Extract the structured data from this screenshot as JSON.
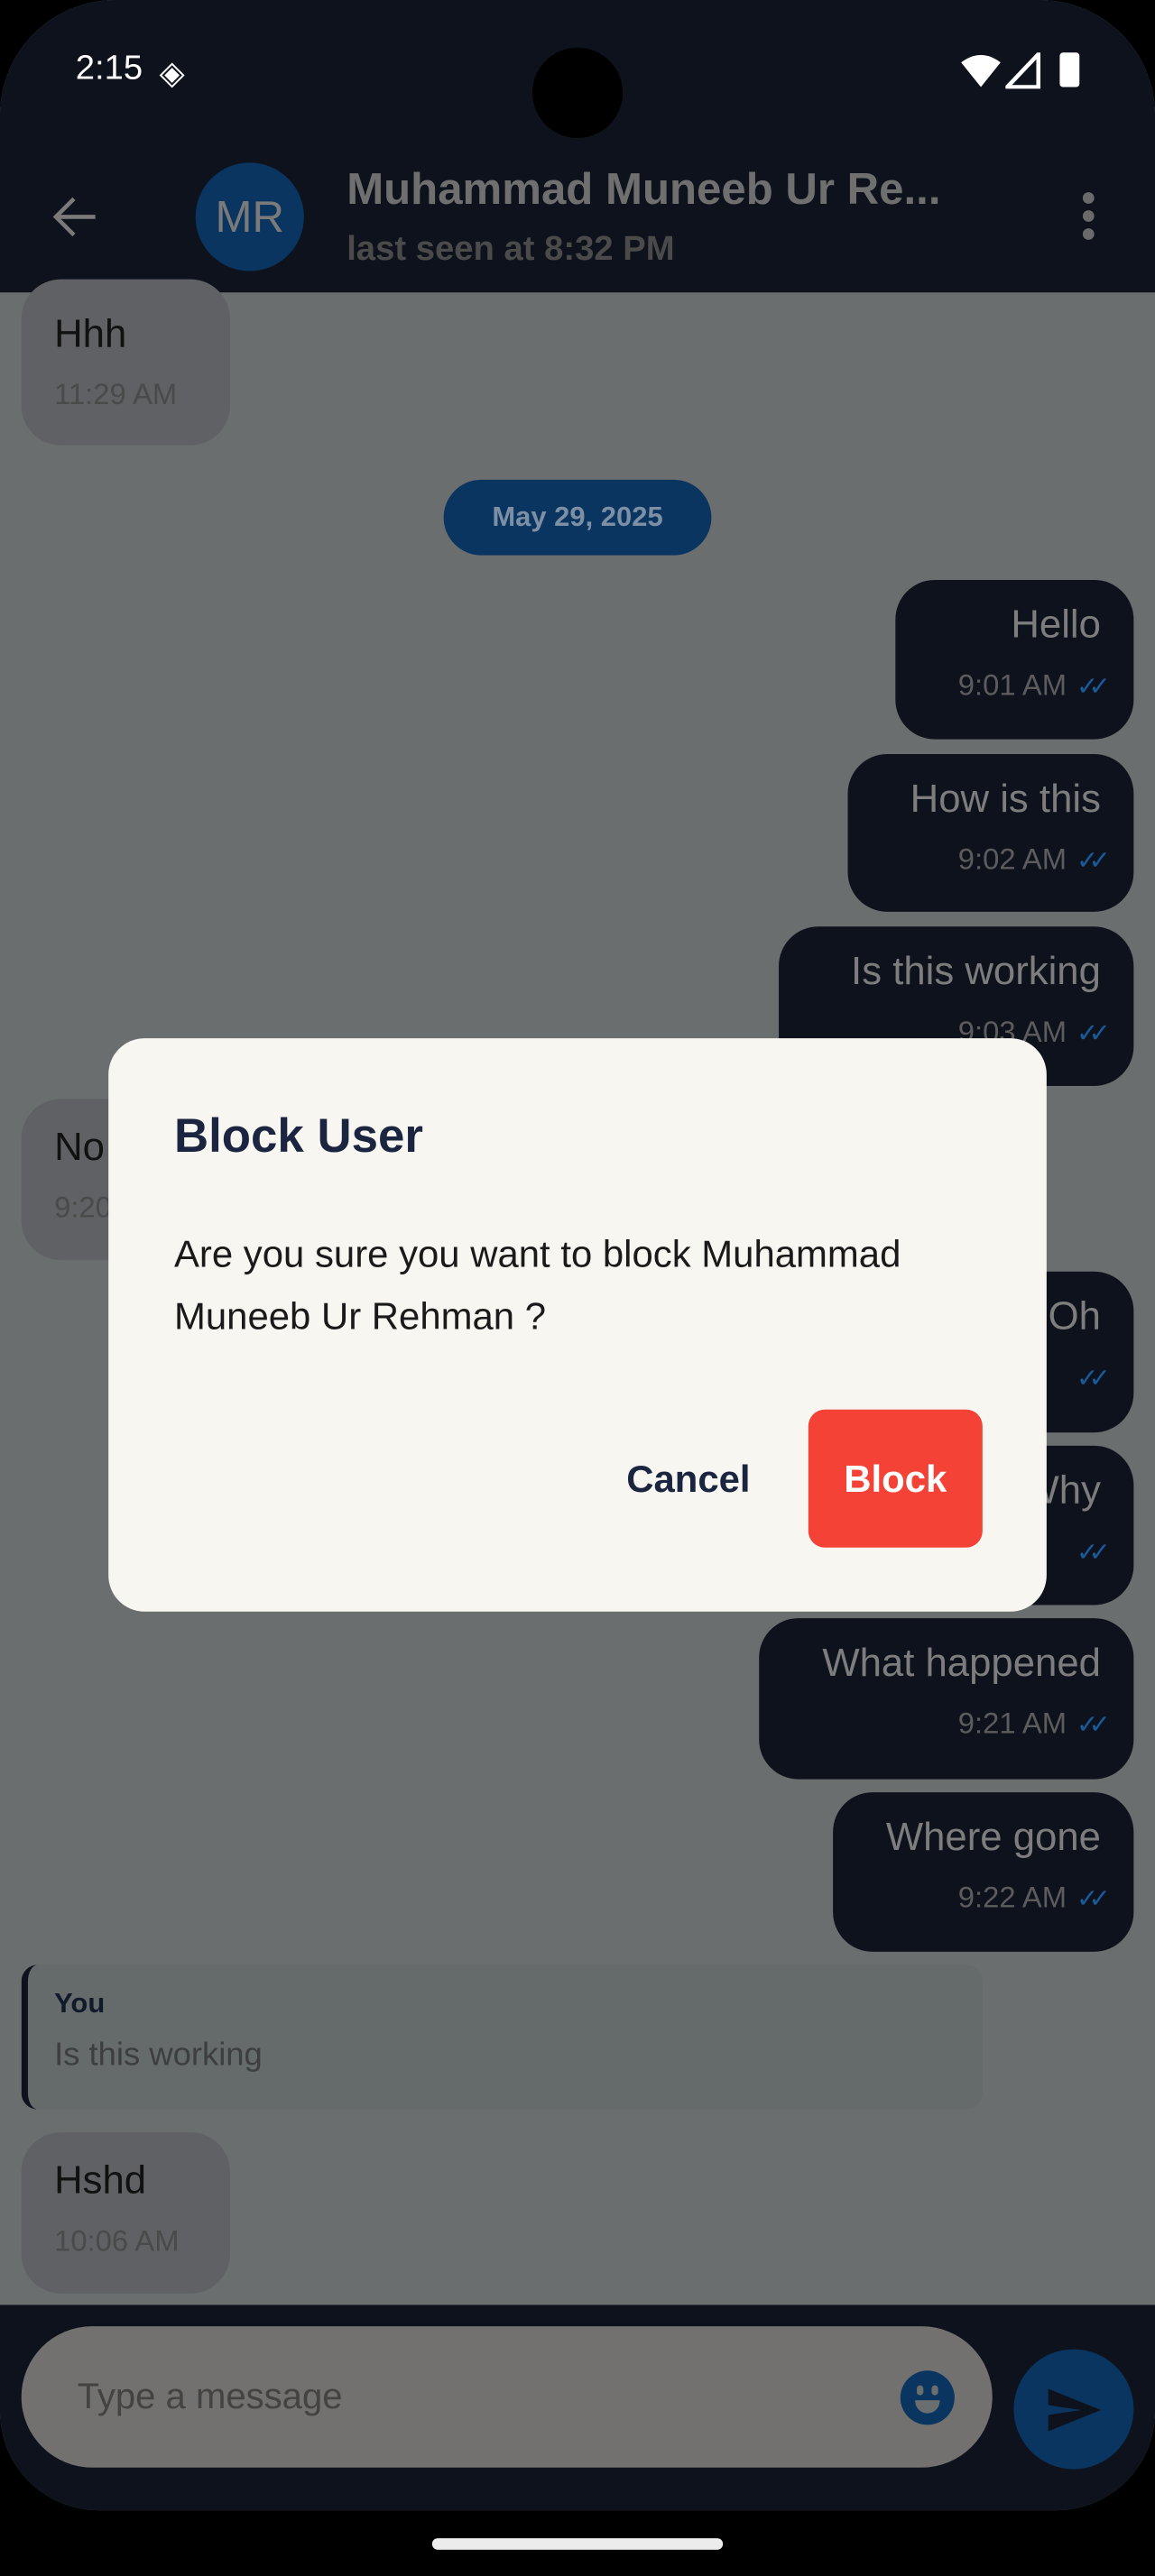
{
  "status_bar": {
    "time": "2:15"
  },
  "header": {
    "avatar_initials": "MR",
    "title": "Muhammad Muneeb Ur Re...",
    "subtitle": "last seen at 8:32 PM"
  },
  "date_chip": "May 29, 2025",
  "messages": [
    {
      "dir": "in",
      "text": "Hhh",
      "time": "11:29 AM"
    },
    {
      "dir": "out",
      "text": "Hello",
      "time": "9:01 AM"
    },
    {
      "dir": "out",
      "text": "How is this",
      "time": "9:02 AM"
    },
    {
      "dir": "out",
      "text": "Is this working",
      "time": "9:03 AM"
    },
    {
      "dir": "in",
      "text": "No",
      "time": "9:20"
    },
    {
      "dir": "out",
      "text": "Oh",
      "time": ""
    },
    {
      "dir": "out",
      "text": "Why",
      "time": ""
    },
    {
      "dir": "out",
      "text": "What happened",
      "time": "9:21 AM"
    },
    {
      "dir": "out",
      "text": "Where gone",
      "time": "9:22 AM"
    },
    {
      "dir": "in",
      "text": "Hshd",
      "time": "10:06 AM"
    }
  ],
  "reply_preview": {
    "author": "You",
    "text": "Is this working"
  },
  "composer": {
    "placeholder": "Type a message"
  },
  "dialog": {
    "title": "Block User",
    "body": "Are you sure you want to block Muhammad Muneeb Ur Rehman ?",
    "cancel": "Cancel",
    "confirm": "Block"
  },
  "colors": {
    "header": "#0e121d",
    "accent": "#0a3560",
    "danger": "#f44336",
    "dialog": "#f7f6f1"
  }
}
